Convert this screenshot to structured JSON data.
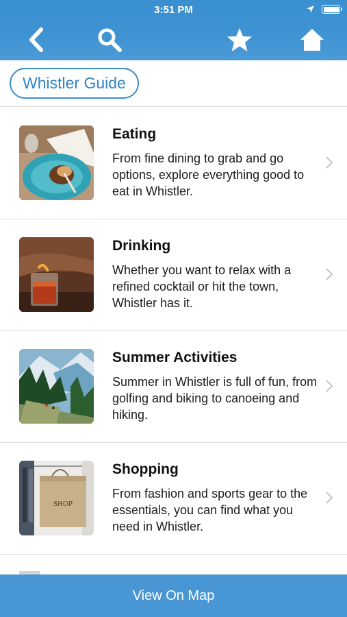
{
  "status_bar": {
    "time": "3:51 PM"
  },
  "nav": {
    "back_icon": "chevron-left-icon",
    "search_icon": "search-icon",
    "favorite_icon": "star-icon",
    "home_icon": "home-icon"
  },
  "title_pill": {
    "label": "Whistler Guide"
  },
  "items": [
    {
      "title": "Eating",
      "description": "From fine dining to grab and go options, explore everything good to eat in Whistler."
    },
    {
      "title": "Drinking",
      "description": "Whether you want to relax with a refined cocktail or hit the town, Whistler has it."
    },
    {
      "title": "Summer Activities",
      "description": "Summer in Whistler is full of fun, from golfing and biking to canoeing and hiking."
    },
    {
      "title": "Shopping",
      "description": "From fashion and sports gear to the essentials, you can find what you need in Whistler.",
      "thumb_sign": "SHOP"
    }
  ],
  "footer": {
    "label": "View On Map"
  },
  "colors": {
    "header": "#3f93d3",
    "accent": "#2f84c6",
    "footer": "#4896d3"
  }
}
